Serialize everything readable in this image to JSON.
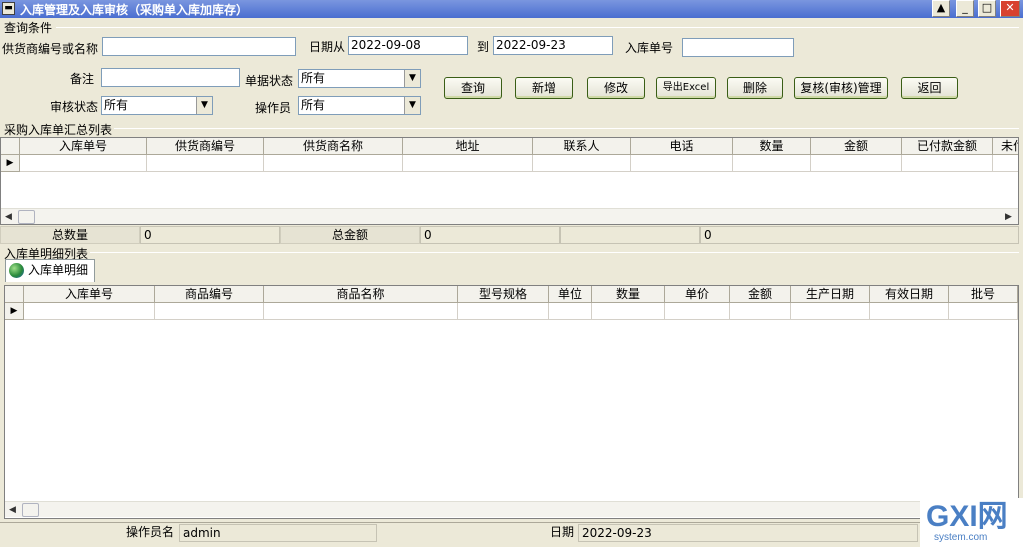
{
  "window": {
    "title": "入库管理及入库审核（采购单入库加库存）"
  },
  "query": {
    "group_label": "查询条件",
    "supplier_label": "供货商编号或名称",
    "supplier_value": "",
    "date_from_label": "日期从",
    "date_from_value": "2022-09-08",
    "date_to_label": "到",
    "date_to_value": "2022-09-23",
    "receipt_no_label": "入库单号",
    "receipt_no_value": "",
    "remark_label": "备注",
    "remark_value": "",
    "doc_status_label": "单据状态",
    "doc_status_value": "所有",
    "audit_status_label": "审核状态",
    "audit_status_value": "所有",
    "operator_label": "操作员",
    "operator_value": "所有"
  },
  "toolbar": {
    "query": "查询",
    "add": "新增",
    "modify": "修改",
    "export": "导出Excel",
    "delete": "删除",
    "review": "复核(审核)管理",
    "back": "返回"
  },
  "summary_list": {
    "group_label": "采购入库单汇总列表",
    "columns": [
      "入库单号",
      "供货商编号",
      "供货商名称",
      "地址",
      "联系人",
      "电话",
      "数量",
      "金额",
      "已付款金额",
      "未付"
    ]
  },
  "totals": {
    "qty_label": "总数量",
    "qty_value": "0",
    "amount_label": "总金额",
    "amount_value": "0",
    "extra_value": "0"
  },
  "detail_list": {
    "group_label": "入库单明细列表",
    "tab_label": "入库单明细",
    "columns": [
      "入库单号",
      "商品编号",
      "商品名称",
      "型号规格",
      "单位",
      "数量",
      "单价",
      "金额",
      "生产日期",
      "有效日期",
      "批号"
    ]
  },
  "statusbar": {
    "operator_label": "操作员名",
    "operator_value": "admin",
    "date_label": "日期",
    "date_value": "2022-09-23"
  },
  "watermark": {
    "text": "GXI网",
    "sub": "system.com"
  }
}
